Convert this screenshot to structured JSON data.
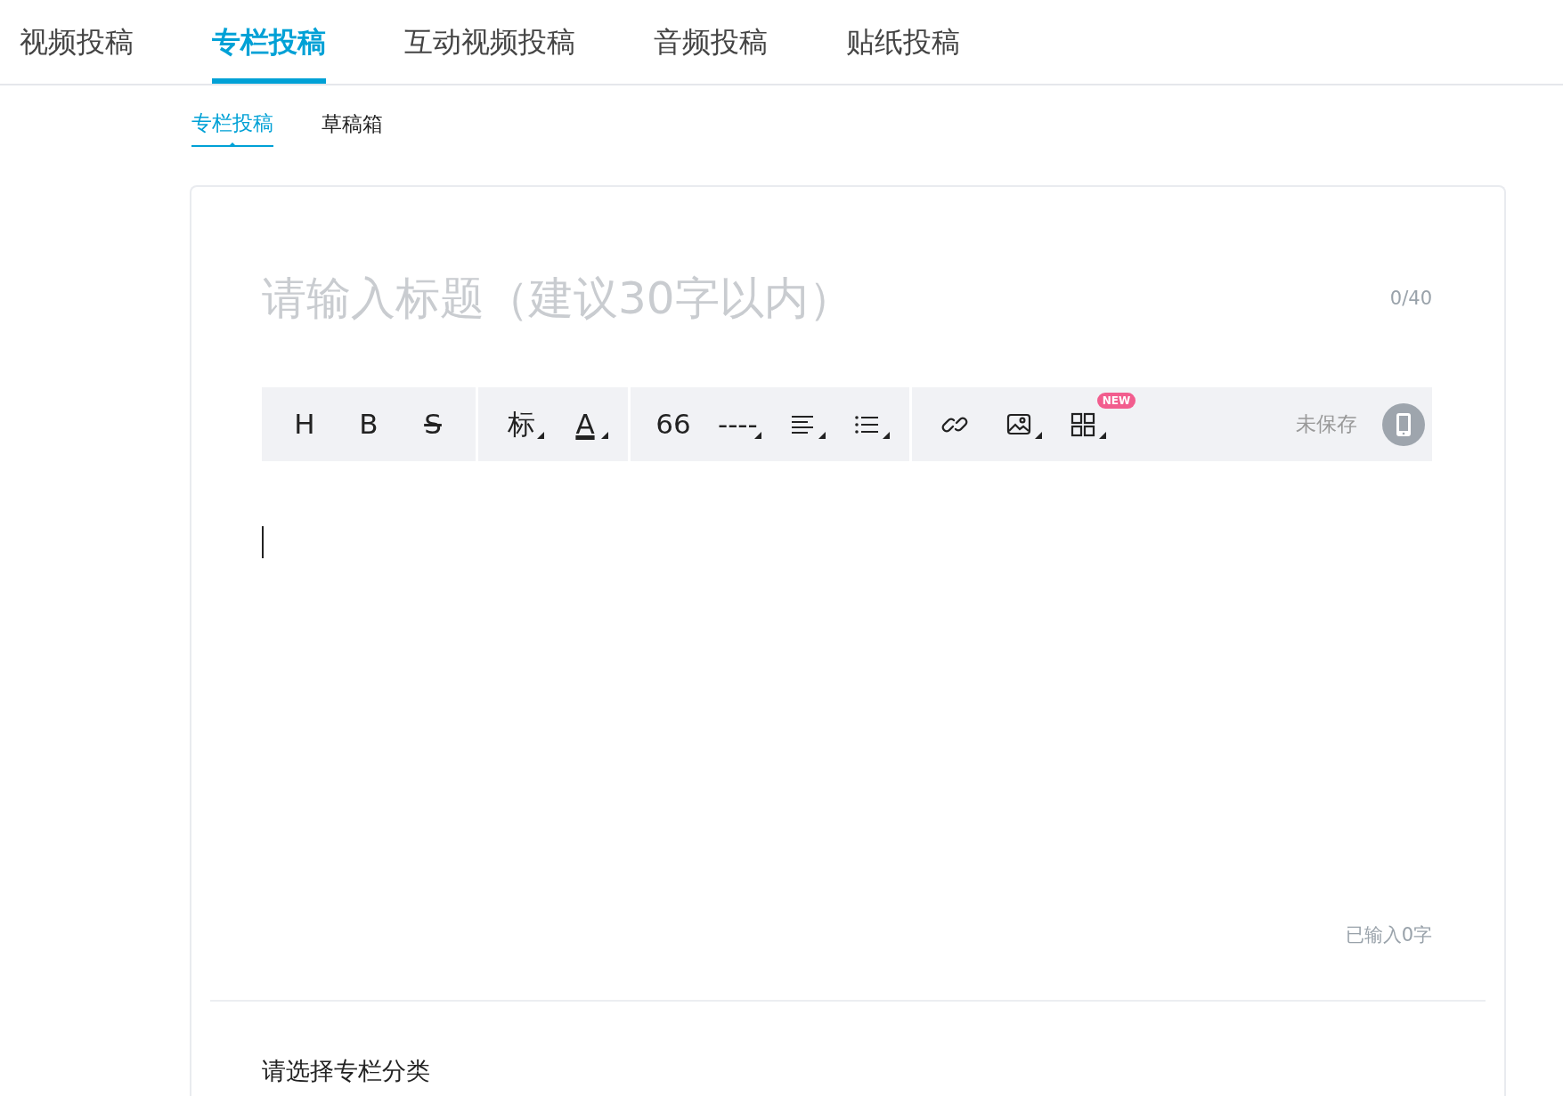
{
  "top_tabs": [
    {
      "label": "视频投稿",
      "selected": false
    },
    {
      "label": "专栏投稿",
      "selected": true
    },
    {
      "label": "互动视频投稿",
      "selected": false
    },
    {
      "label": "音频投稿",
      "selected": false
    },
    {
      "label": "贴纸投稿",
      "selected": false
    }
  ],
  "sub_tabs": [
    {
      "label": "专栏投稿",
      "selected": true
    },
    {
      "label": "草稿箱",
      "selected": false
    }
  ],
  "editor": {
    "title_placeholder": "请输入标题（建议30字以内）",
    "title_count": "0/40",
    "toolbar": {
      "groups": [
        [
          {
            "kind": "text",
            "label": "H",
            "dropdown": false
          },
          {
            "kind": "text",
            "label": "B",
            "dropdown": false
          },
          {
            "kind": "strike",
            "label": "S",
            "dropdown": false
          }
        ],
        [
          {
            "kind": "text",
            "label": "标",
            "dropdown": true
          },
          {
            "kind": "color-text",
            "label": "A",
            "dropdown": true
          }
        ],
        [
          {
            "kind": "text",
            "label": "66",
            "dropdown": false
          },
          {
            "kind": "text",
            "label": "----",
            "dropdown": true
          },
          {
            "kind": "align",
            "dropdown": true
          },
          {
            "kind": "list",
            "dropdown": true
          }
        ],
        [
          {
            "kind": "link",
            "dropdown": false
          },
          {
            "kind": "image",
            "dropdown": true
          },
          {
            "kind": "grid",
            "dropdown": true,
            "badge": "NEW"
          }
        ]
      ],
      "save_status": "未保存"
    },
    "word_count": "已输入0字",
    "category_label": "请选择专栏分类"
  }
}
